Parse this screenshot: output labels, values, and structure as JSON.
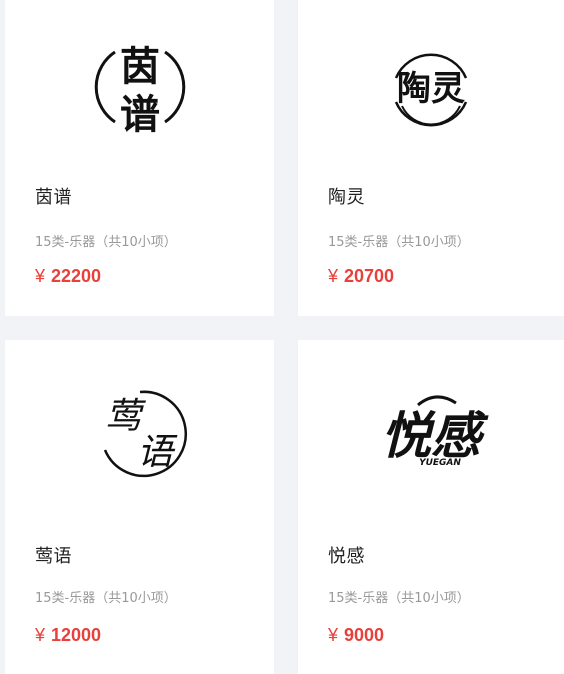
{
  "products": [
    {
      "name": "茵谱",
      "category": "15类-乐器（共10小项）",
      "currency": "¥",
      "price": "22200",
      "logo_icon": "yinpu-logo-icon",
      "logo_text_1": "茵",
      "logo_text_2": "谱"
    },
    {
      "name": "陶灵",
      "category": "15类-乐器（共10小项）",
      "currency": "¥",
      "price": "20700",
      "logo_icon": "taoling-logo-icon",
      "logo_text_1": "陶灵"
    },
    {
      "name": "莺语",
      "category": "15类-乐器（共10小项）",
      "currency": "¥",
      "price": "12000",
      "logo_icon": "yingyu-logo-icon",
      "logo_text_1": "莺",
      "logo_text_2": "语"
    },
    {
      "name": "悦感",
      "category": "15类-乐器（共10小项）",
      "currency": "¥",
      "price": "9000",
      "logo_icon": "yuegan-logo-icon",
      "logo_text_1": "悦感",
      "logo_text_2": "YUEGAN"
    }
  ],
  "colors": {
    "background": "#f2f3f6",
    "card": "#ffffff",
    "price": "#e8403a",
    "name": "#222222",
    "category": "#999999"
  }
}
